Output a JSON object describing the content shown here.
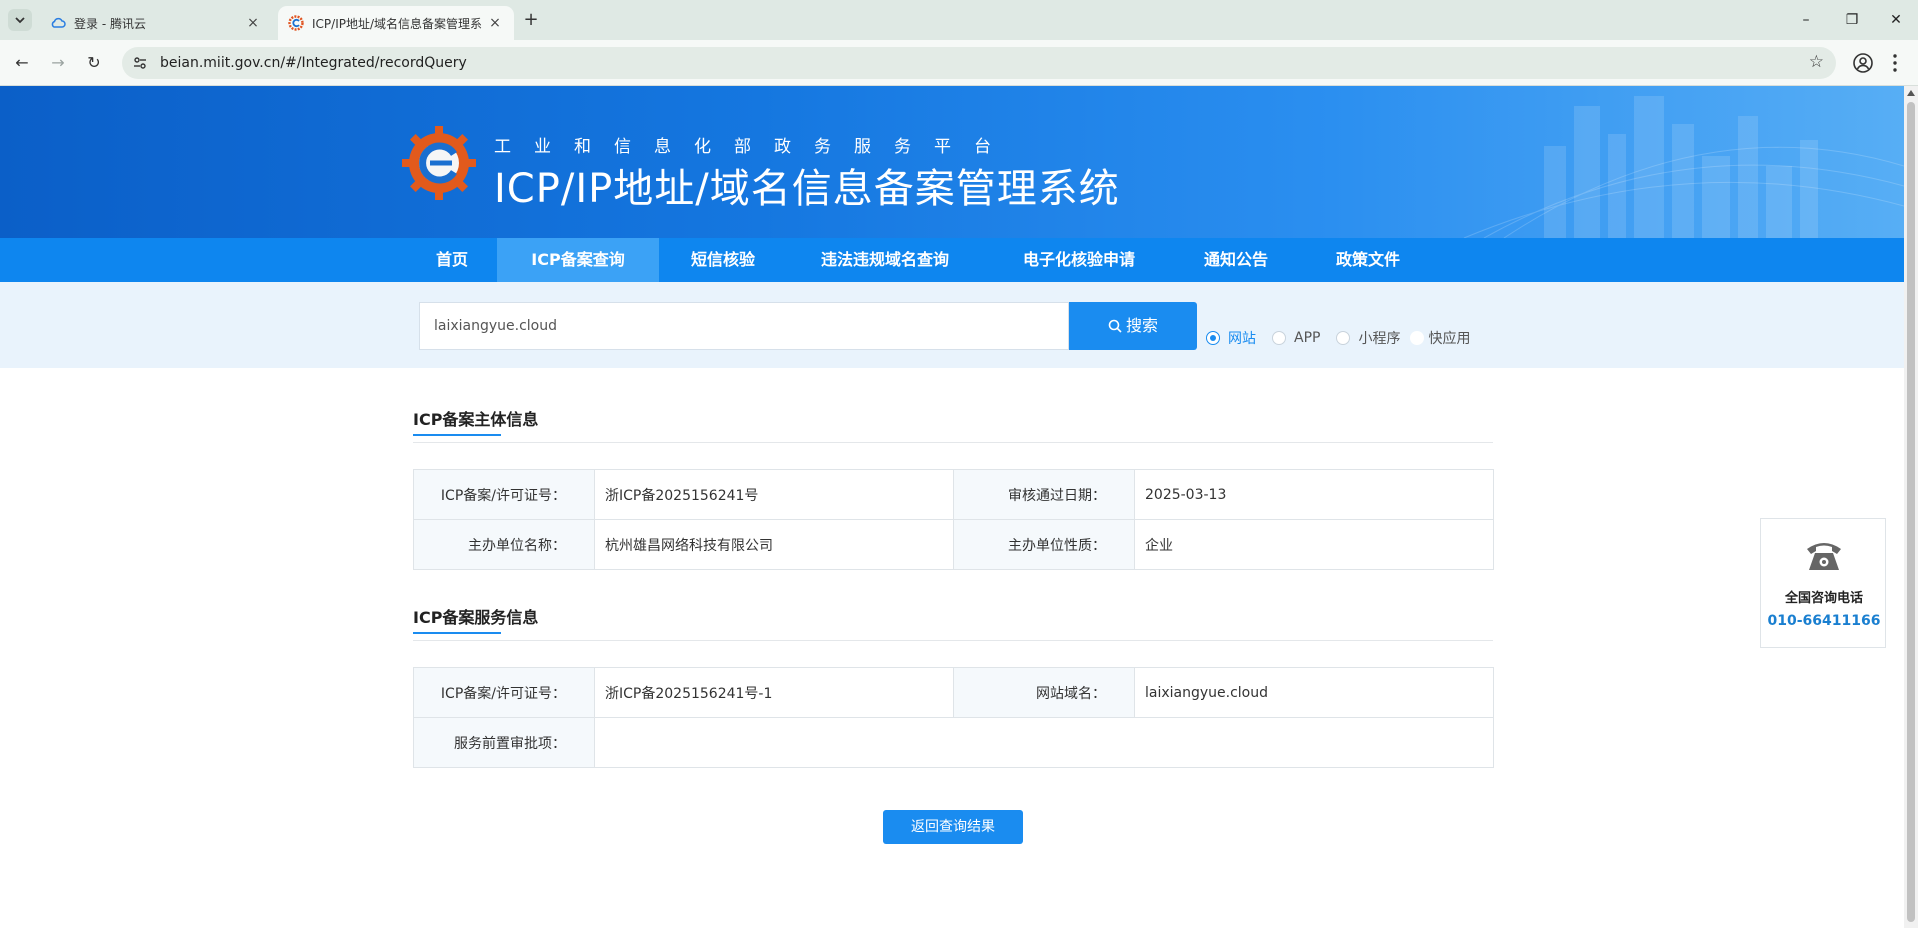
{
  "browser": {
    "tabs": [
      {
        "title": "登录 - 腾讯云",
        "close": "×",
        "icon": "cloud-icon"
      },
      {
        "title": "ICP/IP地址/域名信息备案管理系",
        "close": "×",
        "icon": "miit-gear-icon"
      }
    ],
    "new_tab": "+",
    "window_controls": {
      "minimize": "–",
      "restore": "❐",
      "close": "✕"
    },
    "nav": {
      "back": "←",
      "forward": "→",
      "reload": "↻"
    },
    "url": "beian.miit.gov.cn/#/Integrated/recordQuery",
    "star": "☆"
  },
  "banner": {
    "subtitle": "工业和信息化部政务服务平台",
    "title": "ICP/IP地址/域名信息备案管理系统"
  },
  "nav": {
    "items": [
      {
        "label": "首页"
      },
      {
        "label": "ICP备案查询"
      },
      {
        "label": "短信核验"
      },
      {
        "label": "违法违规域名查询"
      },
      {
        "label": "电子化核验申请"
      },
      {
        "label": "通知公告"
      },
      {
        "label": "政策文件"
      }
    ]
  },
  "search": {
    "value": "laixiangyue.cloud",
    "button": "搜索",
    "options": [
      {
        "label": "网站",
        "checked": true
      },
      {
        "label": "APP",
        "checked": false
      },
      {
        "label": "小程序",
        "checked": false
      },
      {
        "label": "快应用",
        "checked": false
      }
    ]
  },
  "subject": {
    "title": "ICP备案主体信息",
    "rows": [
      {
        "k1": "ICP备案/许可证号：",
        "v1": "浙ICP备2025156241号",
        "k2": "审核通过日期：",
        "v2": "2025-03-13"
      },
      {
        "k1": "主办单位名称：",
        "v1": "杭州雄昌网络科技有限公司",
        "k2": "主办单位性质：",
        "v2": "企业"
      }
    ]
  },
  "service": {
    "title": "ICP备案服务信息",
    "rows": [
      {
        "k1": "ICP备案/许可证号：",
        "v1": "浙ICP备2025156241号-1",
        "k2": "网站域名：",
        "v2": "laixiangyue.cloud"
      },
      {
        "k1": "服务前置审批项：",
        "v1": ""
      }
    ]
  },
  "back_button": "返回查询结果",
  "contact": {
    "label": "全国咨询电话",
    "phone": "010-66411166"
  },
  "colors": {
    "primary": "#1a8cf0",
    "nav_bg": "#0e86ef",
    "banner": "#1577e0"
  }
}
